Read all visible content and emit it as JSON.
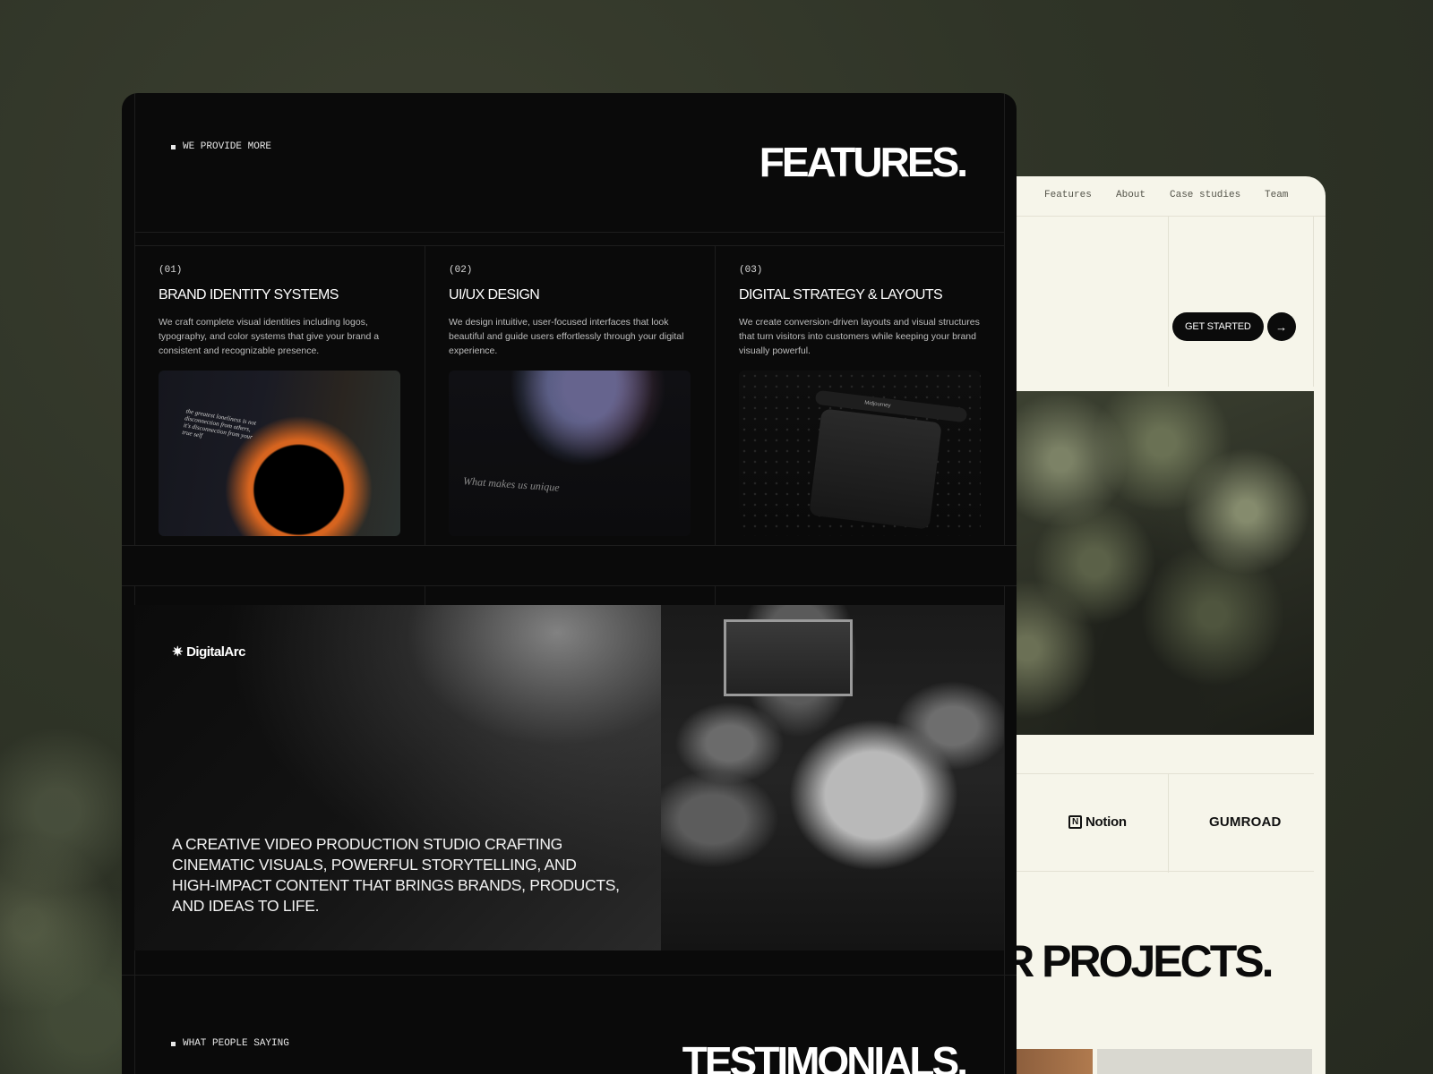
{
  "light": {
    "nav": [
      {
        "label": "Features"
      },
      {
        "label": "About"
      },
      {
        "label": "Case studies"
      },
      {
        "label": "Team"
      }
    ],
    "cta_label": "GET STARTED",
    "cta_arrow": "→",
    "logos": {
      "notion": "Notion",
      "notion_glyph": "N",
      "gumroad": "GUMROAD"
    },
    "projects_title": "UR PROJECTS."
  },
  "dark": {
    "eyebrow": "WE PROVIDE MORE",
    "title": "FEATURES.",
    "features": [
      {
        "num": "(01)",
        "title": "BRAND IDENTITY SYSTEMS",
        "desc": "We craft complete visual identities including logos, typography, and color systems that give your brand a consistent and recognizable presence.",
        "img_text": "the greatest loneliness is not disconnection from others, it's disconnection from your true self"
      },
      {
        "num": "(02)",
        "title": "UI/UX DESIGN",
        "desc": "We design intuitive, user-focused interfaces that look beautiful and guide users effortlessly through your digital experience.",
        "img_text": "What makes us unique"
      },
      {
        "num": "(03)",
        "title": "DIGITAL STRATEGY & LAYOUTS",
        "desc": "We create conversion-driven layouts and visual structures that turn visitors into customers while keeping your brand visually powerful.",
        "img_text": "Midjourney"
      }
    ],
    "hero": {
      "brand": "DigitalArc",
      "brand_glyph": "✷",
      "copy": "A CREATIVE VIDEO PRODUCTION STUDIO CRAFTING CINEMATIC VISUALS, POWERFUL STORYTELLING, AND HIGH-IMPACT CONTENT THAT BRINGS BRANDS, PRODUCTS, AND IDEAS TO LIFE."
    },
    "testimonials_eyebrow": "WHAT PEOPLE SAYING",
    "testimonials_title": "TESTIMONIALS."
  }
}
